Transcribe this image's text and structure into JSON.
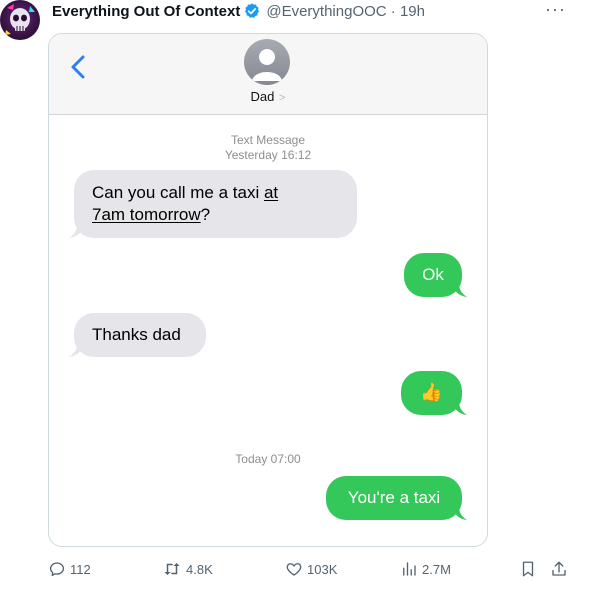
{
  "tweet": {
    "author_name": "Everything Out Of Context",
    "handle": "@EverythingOOC",
    "time_sep": "·",
    "time": "19h",
    "more_icon": "more-horizontal-icon",
    "verified_color": "#1d9bf0"
  },
  "imessage": {
    "contact_name": "Dad",
    "contact_chevron": ">",
    "message_type": "Text Message",
    "first_timestamp": "Yesterday 16:12",
    "second_timestamp": "Today 07:00",
    "messages": [
      {
        "direction": "in",
        "line1_a": "Can you call me a taxi ",
        "line1_b": "at",
        "line2": "7am tomorrow",
        "line2_end": "?"
      },
      {
        "direction": "out",
        "text": "Ok"
      },
      {
        "direction": "in",
        "text": "Thanks dad"
      },
      {
        "direction": "out",
        "text": "👍"
      },
      {
        "direction": "out",
        "text": "You're a taxi"
      }
    ],
    "colors": {
      "incoming": "#e5e5ea",
      "outgoing": "#34c759",
      "back_chevron": "#2f80ed"
    }
  },
  "actions": {
    "replies": "112",
    "retweets": "4.8K",
    "likes": "103K",
    "views": "2.7M"
  }
}
